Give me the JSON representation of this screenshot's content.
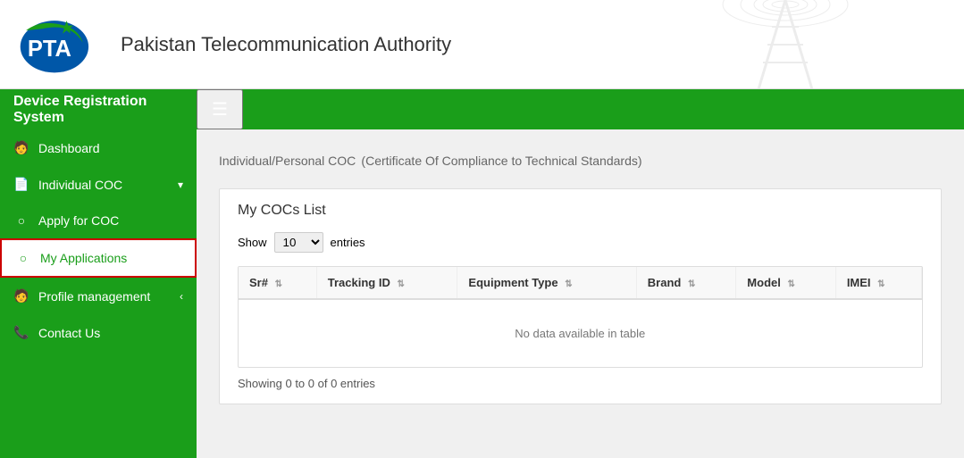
{
  "header": {
    "org_name": "Pakistan Telecommunication Authority"
  },
  "nav": {
    "system_title": "Device Registration System",
    "hamburger_label": "☰"
  },
  "sidebar": {
    "items": [
      {
        "id": "dashboard",
        "label": "Dashboard",
        "icon": "👤",
        "active": false,
        "hasChevron": false
      },
      {
        "id": "individual-coc",
        "label": "Individual COC",
        "icon": "📄",
        "active": false,
        "hasChevron": true
      },
      {
        "id": "apply-for-coc",
        "label": "Apply for COC",
        "icon": "⊙",
        "active": false,
        "hasChevron": false
      },
      {
        "id": "my-applications",
        "label": "My Applications",
        "icon": "⊙",
        "active": true,
        "hasChevron": false
      },
      {
        "id": "profile-management",
        "label": "Profile management",
        "icon": "👤",
        "active": false,
        "hasChevron": true
      },
      {
        "id": "contact-us",
        "label": "Contact Us",
        "icon": "📞",
        "active": false,
        "hasChevron": false
      }
    ]
  },
  "content": {
    "page_title": "Individual/Personal COC",
    "page_subtitle": "(Certificate Of Compliance to Technical Standards)",
    "section_title": "My COCs List",
    "show_label": "Show",
    "entries_label": "entries",
    "show_count": "10",
    "table": {
      "columns": [
        {
          "label": "Sr#",
          "sortable": true
        },
        {
          "label": "Tracking ID",
          "sortable": true
        },
        {
          "label": "Equipment Type",
          "sortable": true
        },
        {
          "label": "Brand",
          "sortable": true
        },
        {
          "label": "Model",
          "sortable": true
        },
        {
          "label": "IMEI",
          "sortable": true
        }
      ],
      "empty_message": "No data available in table",
      "rows": []
    },
    "showing_text": "Showing 0 to 0 of 0 entries"
  }
}
